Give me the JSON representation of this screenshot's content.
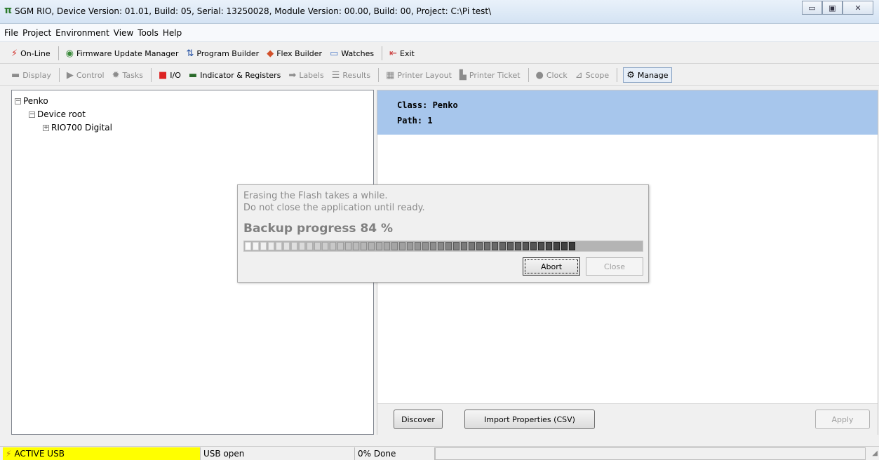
{
  "window": {
    "title": "SGM RIO, Device Version: 01.01, Build: 05, Serial: 13250028, Module Version: 00.00, Build: 00, Project: C:\\Pi test\\",
    "minimize_icon": "minimize-icon",
    "maximize_icon": "maximize-icon",
    "close_icon": "close-icon"
  },
  "menubar": {
    "items": [
      "File",
      "Project",
      "Environment",
      "View",
      "Tools",
      "Help"
    ]
  },
  "toolbar1": {
    "items": [
      {
        "label": "On-Line",
        "icon": "plug-icon"
      },
      {
        "label": "Firmware Update Manager",
        "icon": "firmware-icon"
      },
      {
        "label": "Program Builder",
        "icon": "program-builder-icon"
      },
      {
        "label": "Flex Builder",
        "icon": "flex-builder-icon"
      },
      {
        "label": "Watches",
        "icon": "watches-icon"
      },
      {
        "label": "Exit",
        "icon": "exit-icon"
      }
    ]
  },
  "toolbar2": {
    "items": [
      {
        "label": "Display",
        "icon": "display-icon",
        "enabled": false
      },
      {
        "label": "Control",
        "icon": "play-icon",
        "enabled": false
      },
      {
        "label": "Tasks",
        "icon": "tasks-icon",
        "enabled": false
      },
      {
        "label": "I/O",
        "icon": "io-icon",
        "enabled": true
      },
      {
        "label": "Indicator & Registers",
        "icon": "indicator-icon",
        "enabled": true
      },
      {
        "label": "Labels",
        "icon": "labels-icon",
        "enabled": false
      },
      {
        "label": "Results",
        "icon": "results-icon",
        "enabled": false
      },
      {
        "label": "Printer Layout",
        "icon": "printer-layout-icon",
        "enabled": false
      },
      {
        "label": "Printer Ticket",
        "icon": "printer-icon",
        "enabled": false
      },
      {
        "label": "Clock",
        "icon": "clock-icon",
        "enabled": false
      },
      {
        "label": "Scope",
        "icon": "scope-icon",
        "enabled": false
      },
      {
        "label": "Manage",
        "icon": "manage-icon",
        "enabled": true,
        "pressed": true
      }
    ]
  },
  "tree": {
    "nodes": [
      {
        "label": "Penko",
        "toggle": "−"
      },
      {
        "label": "Device root",
        "toggle": "−"
      },
      {
        "label": "RIO700 Digital",
        "toggle": "+"
      }
    ]
  },
  "info": {
    "class_line": "Class: Penko",
    "path_line": "Path: 1"
  },
  "buttons": {
    "discover": "Discover",
    "import": "Import Properties (CSV)",
    "apply": "Apply"
  },
  "dialog": {
    "line1": "Erasing the Flash takes a while.",
    "line2": "Do not close the application until ready.",
    "progress_text": "Backup progress 84 %",
    "progress_fraction": 0.84,
    "abort": "Abort",
    "close": "Close"
  },
  "status": {
    "active_usb": "ACTIVE USB",
    "usb_open": "USB open",
    "done": "0% Done"
  }
}
